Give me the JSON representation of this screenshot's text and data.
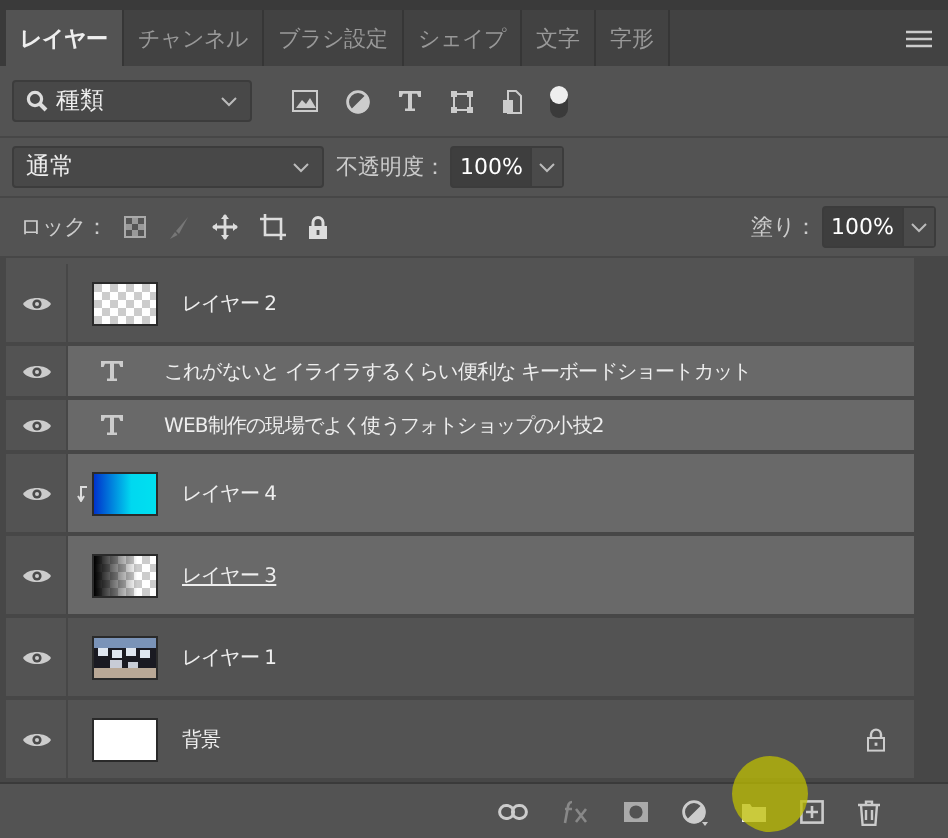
{
  "tabs": [
    {
      "label": "レイヤー",
      "selected": true
    },
    {
      "label": "チャンネル",
      "selected": false
    },
    {
      "label": "ブラシ設定",
      "selected": false
    },
    {
      "label": "シェイプ",
      "selected": false
    },
    {
      "label": "文字",
      "selected": false
    },
    {
      "label": "字形",
      "selected": false
    }
  ],
  "filter": {
    "value": "種類",
    "toggle_on": true
  },
  "blend_mode": {
    "value": "通常"
  },
  "opacity": {
    "label": "不透明度：",
    "value": "100%"
  },
  "lock": {
    "label": "ロック："
  },
  "fill": {
    "label": "塗り：",
    "value": "100%"
  },
  "layers": [
    {
      "name": "レイヤー 2",
      "kind": "transparent",
      "selected": false,
      "visible": true,
      "clipped": false,
      "locked": false,
      "underlined": false
    },
    {
      "name": "これがないと イライラするくらい便利な キーボードショートカット",
      "kind": "text",
      "selected": true,
      "visible": true,
      "clipped": false,
      "locked": false,
      "underlined": false
    },
    {
      "name": "WEB制作の現場でよく使うフォトショップの小技2",
      "kind": "text",
      "selected": true,
      "visible": true,
      "clipped": false,
      "locked": false,
      "underlined": false
    },
    {
      "name": "レイヤー 4",
      "kind": "gradient",
      "selected": true,
      "visible": true,
      "clipped": true,
      "locked": false,
      "underlined": false
    },
    {
      "name": "レイヤー 3",
      "kind": "fade",
      "selected": true,
      "visible": true,
      "clipped": false,
      "locked": false,
      "underlined": true
    },
    {
      "name": "レイヤー 1",
      "selected": false,
      "visible": true,
      "clipped": false,
      "locked": false,
      "underlined": false
    },
    {
      "name": "背景",
      "kind": "plain",
      "selected": false,
      "visible": true,
      "clipped": false,
      "locked": true,
      "underlined": false
    }
  ],
  "cursor_highlight": true
}
